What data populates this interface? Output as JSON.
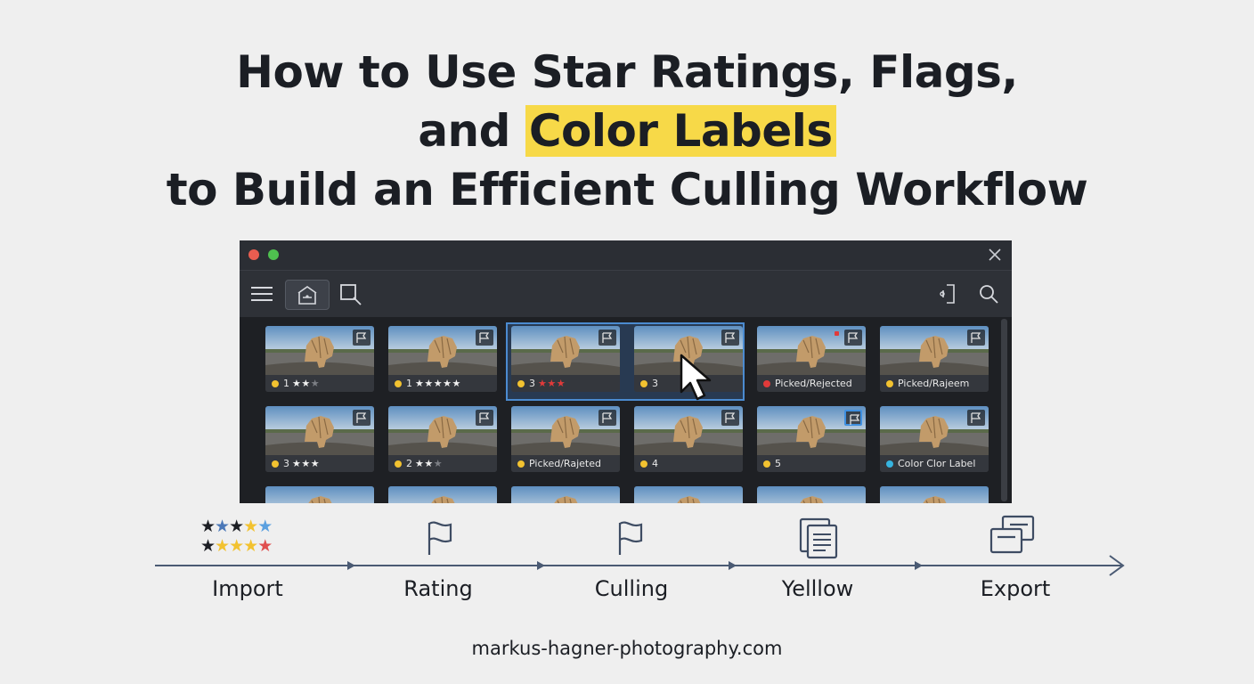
{
  "headline": {
    "line1": "How to Use Star Ratings, Flags,",
    "line2_prefix": "and ",
    "line2_highlight": "Color Labels",
    "line3": "to Build an Efficient Culling Workflow"
  },
  "colors": {
    "highlight": "#f7d948",
    "label_yellow": "#f2c230",
    "label_red": "#e13a3a",
    "label_cyan": "#36b4e0",
    "selection": "#4b8bd0"
  },
  "toolbar": {
    "icons": [
      "menu-icon",
      "library-icon",
      "crop-icon",
      "panel-toggle-icon",
      "search-icon"
    ]
  },
  "thumbnails": [
    {
      "number": "1",
      "stars_on": "★★",
      "stars_off": "★",
      "label_color": "yellow"
    },
    {
      "number": "1",
      "stars_on": "★★★★★",
      "stars_off": "",
      "label_color": "yellow"
    },
    {
      "number": "3",
      "stars_red": "★★★",
      "label_color": "yellow",
      "selected": true
    },
    {
      "number": "3",
      "label_color": "yellow",
      "selected": true
    },
    {
      "text": "Picked/Rejected",
      "label_color": "red"
    },
    {
      "text": "Picked/Rajeem",
      "label_color": "yellow"
    },
    {
      "number": "3",
      "stars_on": "★★★",
      "label_color": "yellow"
    },
    {
      "number": "2",
      "stars_on": "★★",
      "stars_off": "★",
      "label_color": "yellow"
    },
    {
      "text": "Picked/Rajeted",
      "label_color": "yellow"
    },
    {
      "number": "4",
      "label_color": "yellow"
    },
    {
      "number": "5",
      "label_color": "yellow"
    },
    {
      "text": "Color Clor Label",
      "label_color": "cyan"
    }
  ],
  "workflow": {
    "steps": [
      {
        "label": "Import"
      },
      {
        "label": "Rating"
      },
      {
        "label": "Culling"
      },
      {
        "label": "Yelllow"
      },
      {
        "label": "Export"
      }
    ]
  },
  "footer": "markus-hagner-photography.com"
}
